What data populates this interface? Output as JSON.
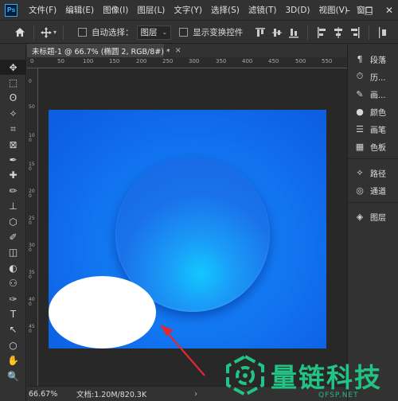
{
  "app": {
    "logo": "Ps"
  },
  "menu": [
    "文件(F)",
    "编辑(E)",
    "图像(I)",
    "图层(L)",
    "文字(Y)",
    "选择(S)",
    "滤镜(T)",
    "3D(D)",
    "视图(V)",
    "窗口"
  ],
  "window_controls": {
    "minimize": "–",
    "maximize": "□",
    "close": "✕"
  },
  "options": {
    "auto_select_label": "自动选择：",
    "auto_select_target": "图层",
    "show_transform_label": "显示变换控件"
  },
  "document": {
    "tab_title": "未标题-1 @ 66.7% (椭圆 2, RGB/8#) *",
    "close": "×",
    "ruler_top": [
      "0",
      "50",
      "100",
      "150",
      "200",
      "250",
      "300",
      "350",
      "400",
      "450",
      "500",
      "550"
    ],
    "ruler_left": [
      "0",
      "50",
      "100",
      "150",
      "200",
      "250",
      "300",
      "350",
      "400",
      "450"
    ]
  },
  "status": {
    "zoom": "66.67%",
    "doc_info": "文档:1.20M/820.3K",
    "caret": "›"
  },
  "panels": {
    "group1": [
      {
        "icon": "paragraph-icon",
        "glyph": "¶",
        "label": "段落"
      },
      {
        "icon": "history-icon",
        "glyph": "⏱",
        "label": "历..."
      },
      {
        "icon": "brush-icon",
        "glyph": "✎",
        "label": "画..."
      },
      {
        "icon": "color-icon",
        "glyph": "●",
        "label": "颜色"
      },
      {
        "icon": "adjust-icon",
        "glyph": "☰",
        "label": "画笔"
      },
      {
        "icon": "swatches-icon",
        "glyph": "▦",
        "label": "色板"
      }
    ],
    "group2": [
      {
        "icon": "paths-icon",
        "glyph": "⟡",
        "label": "路径"
      },
      {
        "icon": "channels-icon",
        "glyph": "◎",
        "label": "通道"
      }
    ],
    "group3": [
      {
        "icon": "layers-icon",
        "glyph": "◈",
        "label": "图层"
      }
    ]
  },
  "tools": [
    "✥",
    "⬚",
    "ʘ",
    "✧",
    "⌗",
    "⊠",
    "✒",
    "✚",
    "✏",
    "⊥",
    "⬡",
    "✐",
    "◫",
    "◐",
    "⚇",
    "✑",
    "T",
    "↖",
    "○",
    "✋",
    "🔍"
  ],
  "watermark": {
    "text": "量链科技",
    "sub": "QFSP.NET"
  }
}
